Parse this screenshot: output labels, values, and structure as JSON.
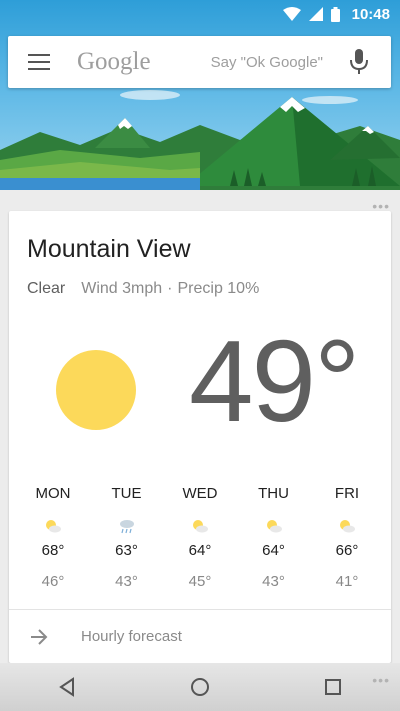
{
  "status_bar": {
    "time": "10:48"
  },
  "search": {
    "logo": "Google",
    "hint": "Say \"Ok Google\""
  },
  "weather": {
    "city": "Mountain View",
    "condition": "Clear",
    "wind": "Wind 3mph",
    "separator": "·",
    "precip": "Precip 10%",
    "temperature": "49°",
    "forecast": [
      {
        "day": "MON",
        "icon": "partly-sunny-icon",
        "high": "68°",
        "low": "46°"
      },
      {
        "day": "TUE",
        "icon": "rain-icon",
        "high": "63°",
        "low": "43°"
      },
      {
        "day": "WED",
        "icon": "partly-sunny-icon",
        "high": "64°",
        "low": "45°"
      },
      {
        "day": "THU",
        "icon": "partly-sunny-icon",
        "high": "64°",
        "low": "43°"
      },
      {
        "day": "FRI",
        "icon": "partly-sunny-icon",
        "high": "66°",
        "low": "41°"
      }
    ],
    "hourly_label": "Hourly forecast"
  },
  "colors": {
    "sun": "#fcd95a",
    "sky": "#5db8e6",
    "grass": "#3f9a3e",
    "water": "#3a8fd0"
  }
}
